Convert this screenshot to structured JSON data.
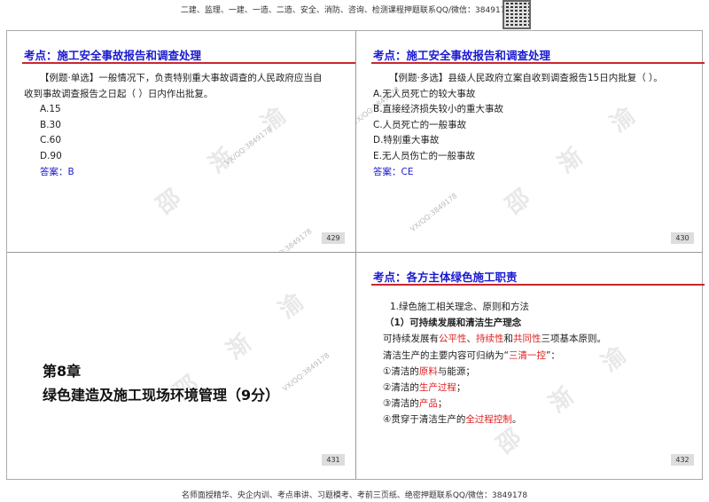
{
  "header": {
    "text": "二建、监理、一建、一造、二造、安全、消防、咨询、检测课程押题联系QQ/微信：3849178"
  },
  "footer": {
    "text": "名师面授精华、央企内训、考点串讲、习题模考、考前三页纸、绝密押题联系QQ/微信：3849178"
  },
  "watermark": {
    "contact": "VX/QQ:3849178",
    "brand": "邵 渐 渝"
  },
  "slides": [
    {
      "title": "考点：施工安全事故报告和调查处理",
      "question": "【例题·单选】一般情况下，负责特别重大事故调查的人民政府应当自",
      "question2": "收到事故调查报告之日起（ ）日内作出批复。",
      "options": [
        "A.15",
        "B.30",
        "C.60",
        "D.90"
      ],
      "answer": "答案：B",
      "page": "429"
    },
    {
      "title": "考点：施工安全事故报告和调查处理",
      "question": "【例题·多选】县级人民政府立案自收到调查报告15日内批复（ ）。",
      "options": [
        "A.无人员死亡的较大事故",
        "B.直接经济损失较小的重大事故",
        "C.人员死亡的一般事故",
        "D.特别重大事故",
        "E.无人员伤亡的一般事故"
      ],
      "answer": "答案：CE",
      "page": "430"
    },
    {
      "chapter": "第8章",
      "chapter_title": "绿色建造及施工现场环境管理（9分）",
      "page": "431"
    },
    {
      "title": "考点：各方主体绿色施工职责",
      "l1": "1.绿色施工相关理念、原则和方法",
      "l2": "（1）可持续发展和清洁生产理念",
      "l3": {
        "a": "可持续发展有",
        "b": "公平性",
        "c": "、",
        "d": "持续性",
        "e": "和",
        "f": "共同性",
        "g": "三项基本原则。"
      },
      "l4": {
        "a": "清洁生产的主要内容可归纳为“",
        "b": "三清一控",
        "c": "”："
      },
      "l5": {
        "a": "①清洁的",
        "b": "原料",
        "c": "与能源；"
      },
      "l6": {
        "a": "②清洁的",
        "b": "生产过程",
        "c": "；"
      },
      "l7": {
        "a": "③清洁的",
        "b": "产品",
        "c": "；"
      },
      "l8": {
        "a": "④贯穿于清洁生产的",
        "b": "全过程控制",
        "c": "。"
      },
      "page": "432"
    }
  ]
}
